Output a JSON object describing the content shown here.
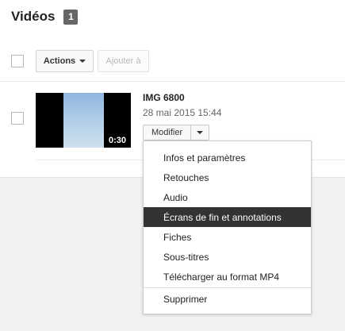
{
  "header": {
    "title": "Vidéos",
    "count": "1"
  },
  "toolbar": {
    "actions_label": "Actions",
    "add_label": "Ajouter à"
  },
  "video": {
    "title": "IMG 6800",
    "date": "28 mai 2015 15:44",
    "duration": "0:30",
    "edit_label": "Modifier"
  },
  "menu": {
    "items": [
      {
        "label": "Infos et paramètres"
      },
      {
        "label": "Retouches"
      },
      {
        "label": "Audio"
      },
      {
        "label": "Écrans de fin et annotations",
        "highlighted": true
      },
      {
        "label": "Fiches"
      },
      {
        "label": "Sous-titres"
      },
      {
        "label": "Télécharger au format MP4"
      }
    ],
    "delete_label": "Supprimer"
  },
  "colors": {
    "badge": "#666666",
    "menu_highlight": "#333333",
    "background": "#f1f1f1"
  },
  "icons": [
    "caret-down-icon"
  ]
}
